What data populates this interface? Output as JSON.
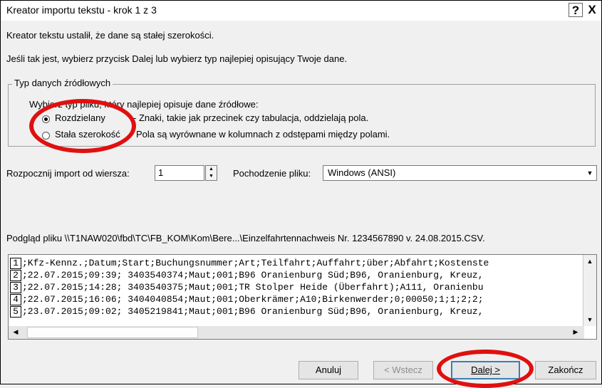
{
  "window": {
    "title": "Kreator importu tekstu - krok 1 z 3",
    "help": "?",
    "close": "X"
  },
  "intro": {
    "line1": "Kreator tekstu ustalił, że dane są stałej szerokości.",
    "line2": "Jeśli tak jest, wybierz przycisk Dalej lub wybierz typ najlepiej opisujący Twoje dane."
  },
  "source_group": {
    "legend": "Typ danych źródłowych",
    "prompt": "Wybierz typ pliku, który najlepiej opisuje dane źródłowe:",
    "options": [
      {
        "label": "Rozdzielany",
        "desc": "- Znaki, takie jak przecinek czy tabulacja, oddzielają pola.",
        "checked": true
      },
      {
        "label": "Stała szerokość",
        "desc": "- Pola są wyrównane w kolumnach z odstępami między polami.",
        "checked": false
      }
    ]
  },
  "import_row": {
    "start_label": "Rozpocznij import od wiersza:",
    "start_value": "1",
    "origin_label": "Pochodzenie pliku:",
    "origin_value": "Windows (ANSI)"
  },
  "preview": {
    "label": "Podgląd pliku \\\\T1NAW020\\fbd\\TC\\FB_KOM\\Kom\\Bere...\\Einzelfahrtennachweis Nr. 1234567890 v. 24.08.2015.CSV.",
    "lines": [
      {
        "num": "1",
        "text": ";Kfz-Kennz.;Datum;Start;Buchungsnummer;Art;Teilfahrt;Auffahrt;über;Abfahrt;Kostenste"
      },
      {
        "num": "2",
        "text": ";22.07.2015;09:39; 3403540374;Maut;001;B96 Oranienburg Süd;B96, Oranienburg, Kreuz,"
      },
      {
        "num": "3",
        "text": ";22.07.2015;14:28; 3403540375;Maut;001;TR Stolper Heide (Überfahrt);A111, Oranienbu"
      },
      {
        "num": "4",
        "text": ";22.07.2015;16:06; 3404040854;Maut;001;Oberkrämer;A10;Birkenwerder;0;00050;1;1;2;2;"
      },
      {
        "num": "5",
        "text": ";23.07.2015;09:02; 3405219841;Maut;001;B96 Oranienburg Süd;B96, Oranienburg, Kreuz,"
      }
    ]
  },
  "buttons": {
    "cancel": "Anuluj",
    "back": "< Wstecz",
    "next": "Dalej >",
    "finish": "Zakończ"
  },
  "colors": {
    "annotation": "#e01010",
    "default_button_border": "#3c7fb1"
  }
}
